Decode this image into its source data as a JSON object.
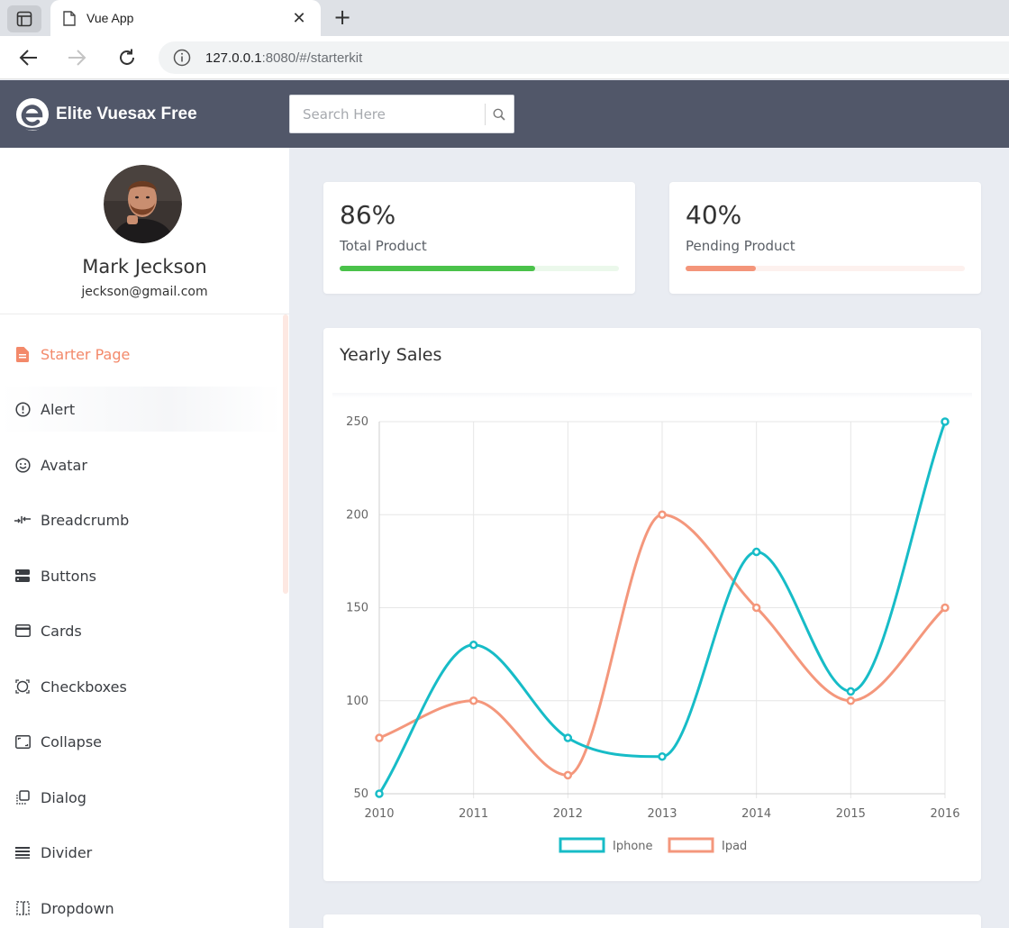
{
  "browser": {
    "tab_title": "Vue App",
    "url_host": "127.0.0.1",
    "url_rest": ":8080/#/starterkit"
  },
  "header": {
    "brand": "Elite Vuesax Free",
    "search_placeholder": "Search Here"
  },
  "profile": {
    "name": "Mark Jeckson",
    "email": "jeckson@gmail.com"
  },
  "sidebar": {
    "items": [
      {
        "label": "Starter Page",
        "icon": "document-icon",
        "active": true
      },
      {
        "label": "Alert",
        "icon": "alert-circle-icon"
      },
      {
        "label": "Avatar",
        "icon": "smiley-icon"
      },
      {
        "label": "Breadcrumb",
        "icon": "breadcrumb-icon"
      },
      {
        "label": "Buttons",
        "icon": "buttons-icon"
      },
      {
        "label": "Cards",
        "icon": "card-icon"
      },
      {
        "label": "Checkboxes",
        "icon": "checkbox-icon"
      },
      {
        "label": "Collapse",
        "icon": "collapse-icon"
      },
      {
        "label": "Dialog",
        "icon": "dialog-icon"
      },
      {
        "label": "Divider",
        "icon": "divider-icon"
      },
      {
        "label": "Dropdown",
        "icon": "dropdown-icon"
      }
    ]
  },
  "stats": [
    {
      "value": "86%",
      "label": "Total Product",
      "progress": 0.7,
      "color": "#4ac24a",
      "track": "#ebf8eb"
    },
    {
      "value": "40%",
      "label": "Pending Product",
      "progress": 0.25,
      "color": "#f4957a",
      "track": "#fdf1ee"
    }
  ],
  "chart_card": {
    "title": "Yearly Sales"
  },
  "chart_data": {
    "type": "line",
    "x": [
      "2010",
      "2011",
      "2012",
      "2013",
      "2014",
      "2015",
      "2016"
    ],
    "series": [
      {
        "name": "Iphone",
        "values": [
          50,
          130,
          80,
          70,
          180,
          105,
          250
        ],
        "color": "#17bcc7"
      },
      {
        "name": "Ipad",
        "values": [
          80,
          100,
          60,
          200,
          150,
          100,
          150
        ],
        "color": "#f4977c"
      }
    ],
    "yticks": [
      "250",
      "200",
      "150",
      "100",
      "50"
    ],
    "ylim": [
      50,
      250
    ],
    "grid": true,
    "legend": "bottom"
  }
}
